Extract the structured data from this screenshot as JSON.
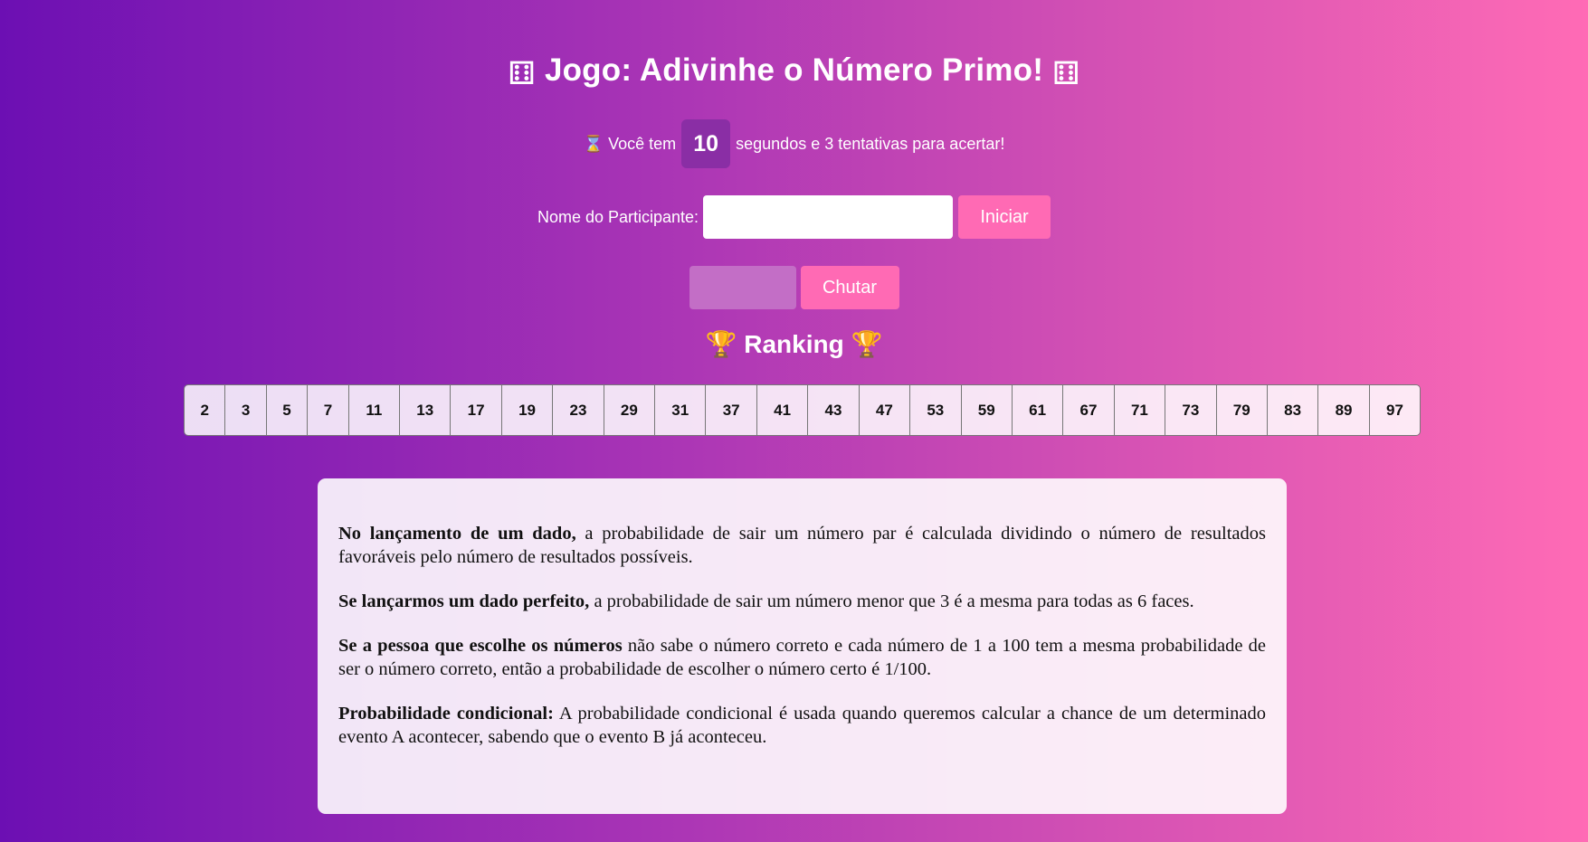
{
  "header": {
    "title": "Jogo: Adivinhe o Número Primo!",
    "dice_symbol": "⚅"
  },
  "timer": {
    "icon": "hourglass-icon",
    "hourglass_symbol": "⌛",
    "prefix": "Você tem",
    "seconds": "10",
    "suffix": "segundos e 3 tentativas para acertar!"
  },
  "participant": {
    "label": "Nome do Participante:",
    "value": "",
    "start_label": "Iniciar"
  },
  "guess": {
    "value": "",
    "button_label": "Chutar"
  },
  "ranking": {
    "title": "Ranking",
    "trophy_symbol": "🏆"
  },
  "primes": [
    "2",
    "3",
    "5",
    "7",
    "11",
    "13",
    "17",
    "19",
    "23",
    "29",
    "31",
    "37",
    "41",
    "43",
    "47",
    "53",
    "59",
    "61",
    "67",
    "71",
    "73",
    "79",
    "83",
    "89",
    "97"
  ],
  "info": {
    "paragraphs": [
      {
        "bold": "No lançamento de um dado,",
        "text": " a probabilidade de sair um número par é calculada dividindo o número de resultados favoráveis pelo número de resultados possíveis."
      },
      {
        "bold": "Se lançarmos um dado perfeito,",
        "text": " a probabilidade de sair um número menor que 3 é a mesma para todas as 6 faces."
      },
      {
        "bold": "Se a pessoa que escolhe os números",
        "text": " não sabe o número correto e cada número de 1 a 100 tem a mesma probabilidade de ser o número correto, então a probabilidade de escolher o número certo é 1/100."
      },
      {
        "bold": "Probabilidade condicional:",
        "text": " A probabilidade condicional é usada quando queremos calcular a chance de um determinado evento A acontecer, sabendo que o evento B já aconteceu."
      }
    ]
  },
  "colors": {
    "gradient_start": "#6c0fb3",
    "gradient_end": "#ff6bb5",
    "button": "#ff6ab4",
    "timer_box": "#8a2ea5"
  }
}
